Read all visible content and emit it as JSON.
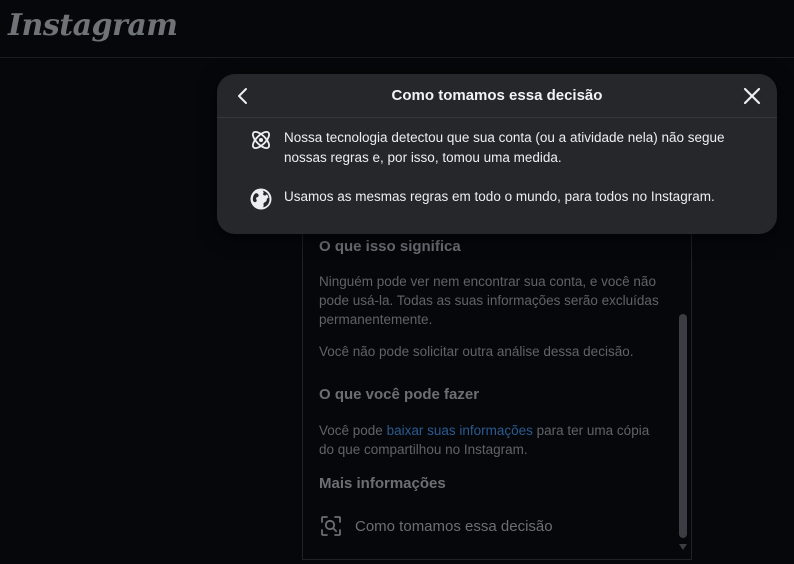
{
  "app": {
    "logo_text": "Instagram"
  },
  "panel": {
    "section1_title": "O que isso significa",
    "section1_para1": "Ninguém pode ver nem encontrar sua conta, e você não pode usá-la. Todas as suas informações serão excluídas permanentemente.",
    "section1_para2": "Você não pode solicitar outra análise dessa decisão.",
    "section2_title": "O que você pode fazer",
    "section2_prefix": "Você pode ",
    "section2_link": "baixar suas informações",
    "section2_suffix": " para ter uma cópia do que compartilhou no Instagram.",
    "section3_title": "Mais informações",
    "more_item_label": "Como tomamos essa decisão"
  },
  "modal": {
    "title": "Como tomamos essa decisão",
    "rows": [
      {
        "icon": "technology-atom-icon",
        "text": "Nossa tecnologia detectou que sua conta (ou a atividade nela) não segue nossas regras e, por isso, tomou uma medida."
      },
      {
        "icon": "globe-icon",
        "text": "Usamos as mesmas regras em todo o mundo, para todos no Instagram."
      }
    ]
  },
  "colors": {
    "background": "#05070a",
    "modal_bg": "#25272b",
    "link": "#2d5a8f"
  }
}
